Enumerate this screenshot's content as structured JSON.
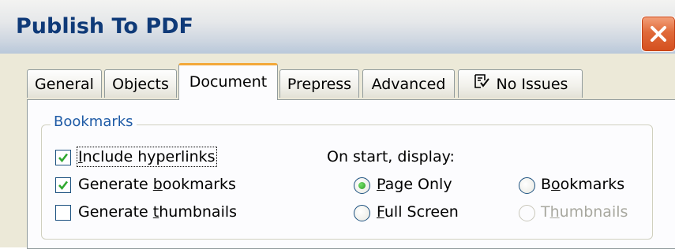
{
  "window": {
    "title": "Publish To PDF"
  },
  "tabs": [
    {
      "label": "General"
    },
    {
      "label": "Objects"
    },
    {
      "label": "Document"
    },
    {
      "label": "Prepress"
    },
    {
      "label": "Advanced"
    },
    {
      "label": "No Issues"
    }
  ],
  "bookmarks_group": {
    "label": "Bookmarks",
    "checkboxes": [
      {
        "pre": "",
        "key": "I",
        "post": "nclude hyperlinks",
        "checked": true
      },
      {
        "pre": "Generate ",
        "key": "b",
        "post": "ookmarks",
        "checked": true
      },
      {
        "pre": "Generate ",
        "key": "t",
        "post": "humbnails",
        "checked": false
      }
    ],
    "display_label": "On start, display:",
    "radios": [
      {
        "pre": "",
        "key": "P",
        "post": "age Only",
        "selected": true,
        "enabled": true
      },
      {
        "pre": "",
        "key": "F",
        "post": "ull Screen",
        "selected": false,
        "enabled": true
      },
      {
        "pre": "B",
        "key": "o",
        "post": "okmarks",
        "selected": false,
        "enabled": true
      },
      {
        "pre": "T",
        "key": "h",
        "post": "umbnails",
        "selected": false,
        "enabled": false
      }
    ]
  },
  "colors": {
    "title_text": "#0f3a78",
    "group_label": "#1f5ba6",
    "active_tab_accent": "#f3a83a",
    "check_green": "#2fa82f"
  }
}
